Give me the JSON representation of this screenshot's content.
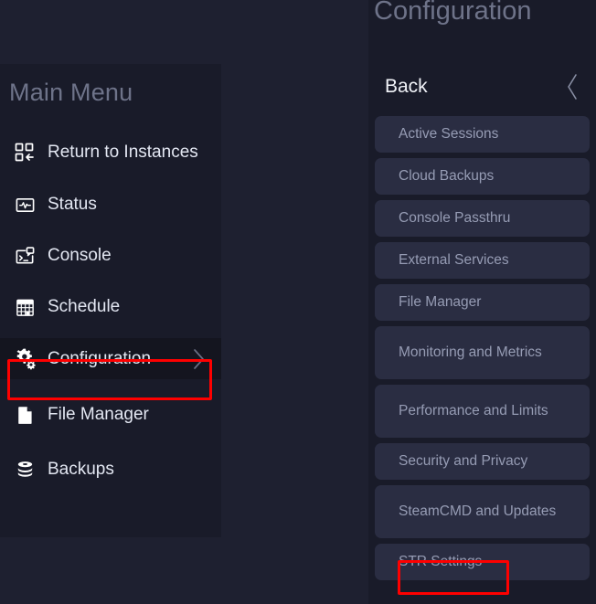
{
  "left_menu": {
    "title": "Main Menu",
    "items": [
      {
        "label": "Return to Instances",
        "icon": "grid-arrow-left-icon",
        "chevron": false
      },
      {
        "label": "Status",
        "icon": "monitor-pulse-icon",
        "chevron": false
      },
      {
        "label": "Console",
        "icon": "terminal-chat-icon",
        "chevron": false
      },
      {
        "label": "Schedule",
        "icon": "calendar-grid-icon",
        "chevron": false
      },
      {
        "label": "Configuration",
        "icon": "gears-icon",
        "chevron": true
      },
      {
        "label": "File Manager",
        "icon": "document-page-icon",
        "chevron": false
      },
      {
        "label": "Backups",
        "icon": "database-stack-icon",
        "chevron": false
      }
    ]
  },
  "right_panel": {
    "title": "Configuration",
    "back_label": "Back",
    "back_icon": "chevron-left-icon",
    "nav_items": [
      {
        "label": "Active Sessions"
      },
      {
        "label": "Cloud Backups"
      },
      {
        "label": "Console Passthru"
      },
      {
        "label": "External Services"
      },
      {
        "label": "File Manager"
      },
      {
        "label": "Monitoring and Metrics"
      },
      {
        "label": "Performance and Limits"
      },
      {
        "label": "Security and Privacy"
      },
      {
        "label": "SteamCMD and Updates"
      },
      {
        "label": "STR Settings"
      }
    ]
  },
  "annotations": {
    "highlight_color": "#fe0000",
    "configuration_highlight": "Configuration",
    "str_settings_highlight": "STR Settings"
  }
}
